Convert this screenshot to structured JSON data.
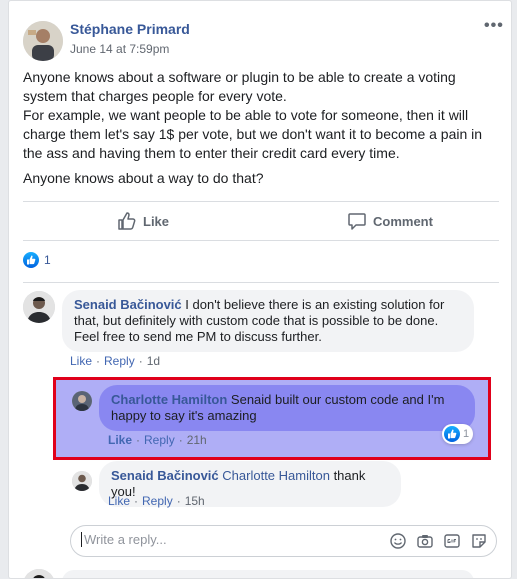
{
  "post": {
    "author": "Stéphane Primard",
    "time": "June 14 at 7:59pm",
    "more_icon": "more-horizontal-icon",
    "text_lines": [
      "Anyone knows about a software or plugin to be able to create a voting",
      "system that charges people for every vote.",
      "For example, we want people to be able to vote for someone, then it will",
      "charge them let's say 1$ per vote, but we don't want it to become a pain in",
      "the ass and having them to enter their credit card every time."
    ],
    "text_question": "Anyone knows about a way to do that?"
  },
  "actions": {
    "like_label": "Like",
    "comment_label": "Comment"
  },
  "reactions": {
    "count": "1",
    "icon": "like-badge-icon"
  },
  "comments": [
    {
      "author": "Senaid Bačinović",
      "text": "I don't believe there is an existing solution for that, but definitely with custom code that is possible to be done. Feel free to send me PM to discuss further.",
      "like": "Like",
      "reply": "Reply",
      "time": "1d"
    }
  ],
  "replies": [
    {
      "author": "Charlotte Hamilton",
      "text": "Senaid built our custom code and I'm happy to say it's amazing",
      "like": "Like",
      "reply": "Reply",
      "time": "21h",
      "reaction_count": "1"
    },
    {
      "author": "Senaid Bačinović",
      "tag": "Charlotte Hamilton",
      "text": "thank you!",
      "like": "Like",
      "reply": "Reply",
      "time": "15h"
    }
  ],
  "reply_box": {
    "placeholder": "Write a reply...",
    "icons": [
      "emoji-icon",
      "camera-icon",
      "gif-icon",
      "sticker-icon"
    ]
  },
  "colors": {
    "link": "#385898",
    "highlight_border": "#e0001b",
    "highlight_fill": "#7a78f0"
  }
}
